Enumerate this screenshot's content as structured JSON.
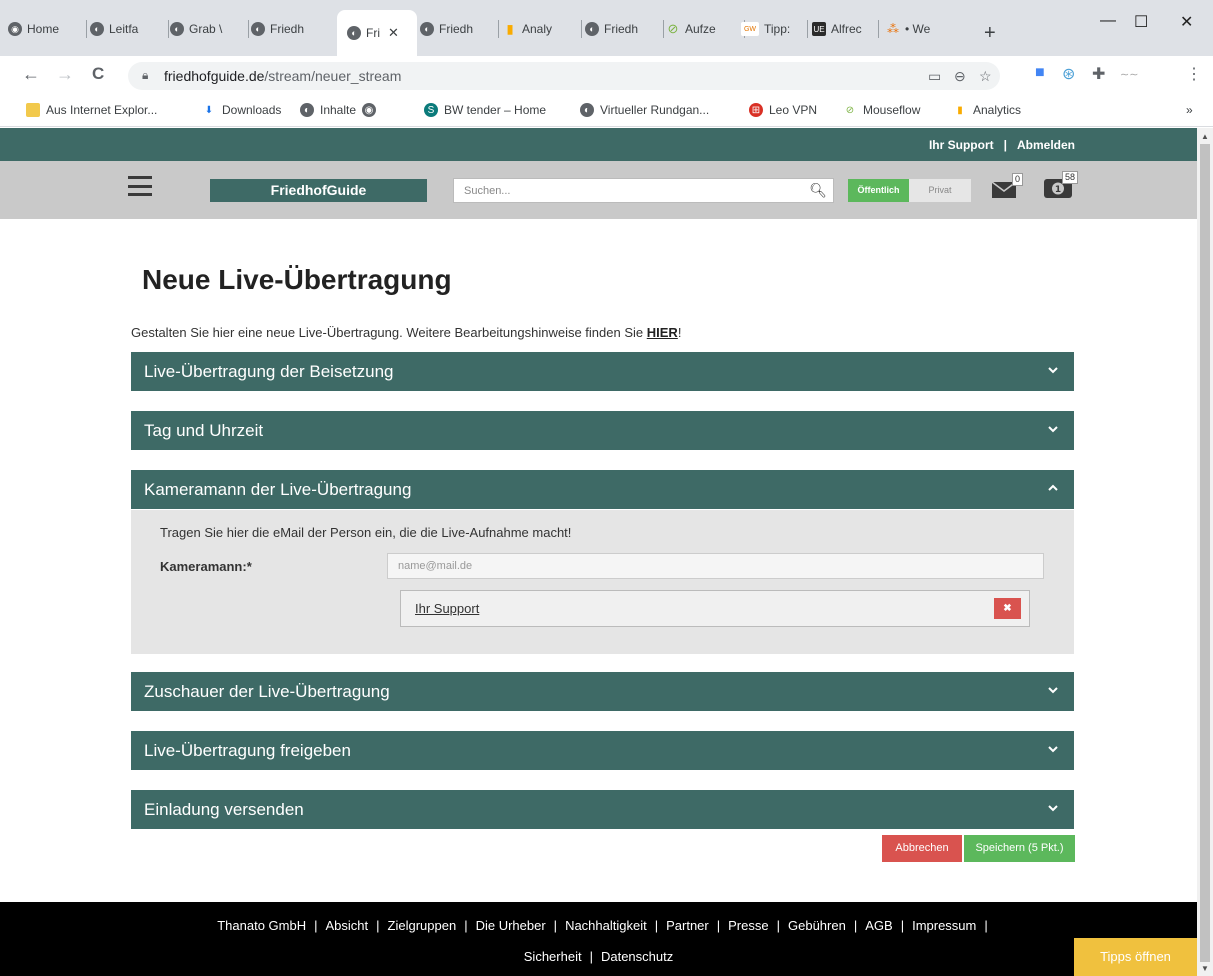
{
  "browser": {
    "tabs": [
      {
        "label": "Home",
        "icon": "globe-icon",
        "glyph": "◉"
      },
      {
        "label": "Leitfa",
        "icon": "site-icon",
        "glyph": "◐"
      },
      {
        "label": "Grab \\",
        "icon": "site-icon",
        "glyph": "◐"
      },
      {
        "label": "Friedh",
        "icon": "site-icon",
        "glyph": "◐"
      },
      {
        "label": "Fri",
        "icon": "site-icon",
        "glyph": "◐"
      },
      {
        "label": "Friedh",
        "icon": "site-icon",
        "glyph": "◐"
      },
      {
        "label": "Analy",
        "icon": "analytics-icon",
        "glyph": "▮"
      },
      {
        "label": "Friedh",
        "icon": "site-icon",
        "glyph": "◐"
      },
      {
        "label": "Aufze",
        "icon": "swirl-icon",
        "glyph": "⊘"
      },
      {
        "label": "Tipp:",
        "icon": "gw-icon",
        "glyph": "GW"
      },
      {
        "label": "Alfrec",
        "icon": "ue-icon",
        "glyph": "UE"
      },
      {
        "label": "• We",
        "icon": "dots-icon",
        "glyph": "⁂"
      }
    ],
    "tab_close": "✕",
    "new_tab": "+",
    "window": {
      "minimize": "—",
      "maximize": "☐",
      "close": "✕"
    },
    "nav": {
      "back": "←",
      "forward": "→",
      "reload": "C"
    },
    "url_host": "friedhofguide.de",
    "url_path": "/stream/neuer_stream",
    "bookmarks": [
      {
        "label": "Aus Internet Explor...",
        "icon": "folder-icon",
        "glyph": ""
      },
      {
        "label": "Downloads",
        "icon": "download-icon",
        "glyph": "⬇"
      },
      {
        "label": "Inhalte",
        "icon": "site-icon",
        "glyph": "◐"
      },
      {
        "label": "",
        "icon": "globe-icon",
        "glyph": "◉"
      },
      {
        "label": "BW tender – Home",
        "icon": "sharepoint-icon",
        "glyph": "S"
      },
      {
        "label": "Virtueller Rundgan...",
        "icon": "site-icon",
        "glyph": "◐"
      },
      {
        "label": "Leo VPN",
        "icon": "vpn-icon",
        "glyph": "⊞"
      },
      {
        "label": "Mouseflow",
        "icon": "swirl-icon",
        "glyph": "⊘"
      },
      {
        "label": "Analytics",
        "icon": "analytics-icon",
        "glyph": "▮"
      }
    ],
    "bookmarks_more": "»"
  },
  "site": {
    "top_links": [
      "Ihr Support",
      "|",
      "Abmelden"
    ],
    "logo": "FriedhofGuide",
    "search_placeholder": "Suchen...",
    "toggle_public": "Öffentlich",
    "toggle_private": "Privat",
    "mail_count": "0",
    "coin_count": "58"
  },
  "main": {
    "title": "Neue Live-Übertragung",
    "intro_text": "Gestalten Sie hier eine neue Live-Übertragung. Weitere Bearbeitungshinweise finden Sie ",
    "intro_link": "HIER",
    "intro_end": "!",
    "sections": [
      {
        "label": "Live-Übertragung der Beisetzung",
        "expanded": false
      },
      {
        "label": "Tag und Uhrzeit",
        "expanded": false
      },
      {
        "label": "Kameramann der Live-Übertragung",
        "expanded": true
      },
      {
        "label": "Zuschauer der Live-Übertragung",
        "expanded": false
      },
      {
        "label": "Live-Übertragung freigeben",
        "expanded": false
      },
      {
        "label": "Einladung versenden",
        "expanded": false
      }
    ],
    "camera_panel": {
      "hint": "Tragen Sie hier die eMail der Person ein, die die Live-Aufnahme macht!",
      "field_label": "Kameramann:*",
      "field_placeholder": "name@mail.de",
      "tag": "Ihr Support",
      "remove_glyph": "✖"
    },
    "cancel_label": "Abbrechen",
    "save_label": "Speichern (5 Pkt.)"
  },
  "footer": {
    "row1": [
      "Thanato GmbH",
      "Absicht",
      "Zielgruppen",
      "Die Urheber",
      "Nachhaltigkeit",
      "Partner",
      "Presse",
      "Gebühren",
      "AGB",
      "Impressum"
    ],
    "row2": [
      "Sicherheit",
      "Datenschutz"
    ],
    "tips_button": "Tipps öffnen"
  },
  "colors": {
    "brand_teal": "#3e6a66",
    "success_green": "#5cb85c",
    "danger_red": "#d9534f",
    "tips_yellow": "#f0c13e"
  }
}
